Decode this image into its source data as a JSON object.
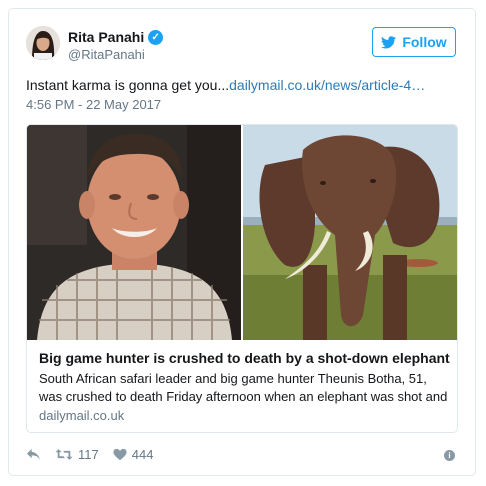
{
  "user": {
    "display_name": "Rita Panahi",
    "handle": "@RitaPanahi",
    "verified_icon": "verified-badge-icon"
  },
  "follow_button": {
    "label": "Follow",
    "icon": "twitter-bird-icon",
    "color": "#1da1f2"
  },
  "tweet": {
    "text": "Instant karma is gonna get you...",
    "link": "dailymail.co.uk/news/article-4…",
    "timestamp": "4:56 PM - 22 May 2017"
  },
  "card": {
    "title": "Big game hunter is crushed to death by a shot-down elephant",
    "description": "South African safari leader and big game hunter Theunis Botha, 51, was crushed to death Friday afternoon when an elephant was shot and",
    "domain": "dailymail.co.uk"
  },
  "actions": {
    "reply_icon": "reply-icon",
    "retweet_icon": "retweet-icon",
    "retweet_count": "117",
    "like_icon": "heart-icon",
    "like_count": "444",
    "info_icon": "info-icon"
  },
  "colors": {
    "link": "#2b7bb9",
    "secondary_text": "#657786",
    "border": "#e1e8ed"
  }
}
